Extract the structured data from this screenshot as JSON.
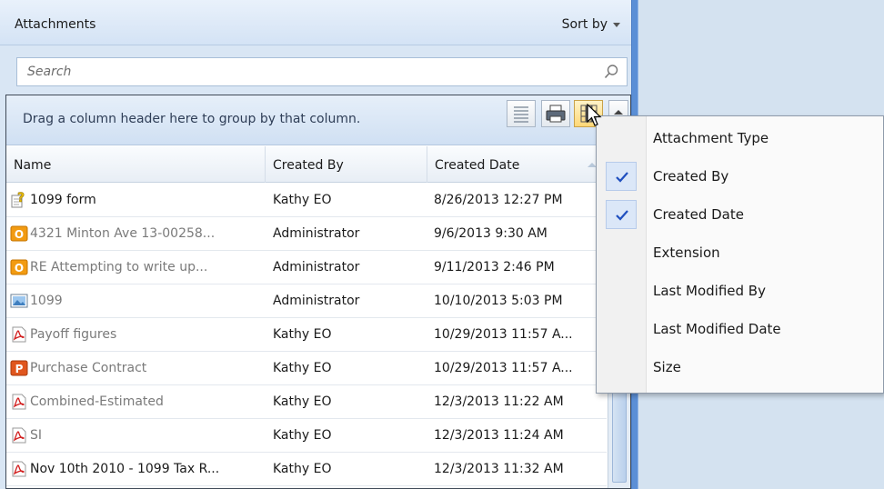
{
  "header": {
    "title": "Attachments",
    "sort_label": "Sort by"
  },
  "search": {
    "placeholder": "Search"
  },
  "grid": {
    "group_hint": "Drag a column header here to group by that column.",
    "columns": [
      "Name",
      "Created By",
      "Created Date"
    ],
    "rows": [
      {
        "icon": "help-doc-icon",
        "name": "1099 form",
        "created_by": "Kathy EO",
        "created_date": "8/26/2013 12:27 PM",
        "name_dim": false
      },
      {
        "icon": "outlook-icon",
        "name": "4321 Minton Ave 13-00258...",
        "created_by": "Administrator",
        "created_date": "9/6/2013 9:30 AM",
        "name_dim": true
      },
      {
        "icon": "outlook-icon",
        "name": "RE  Attempting to write up...",
        "created_by": "Administrator",
        "created_date": "9/11/2013 2:46 PM",
        "name_dim": true
      },
      {
        "icon": "image-icon",
        "name": "1099",
        "created_by": "Administrator",
        "created_date": "10/10/2013 5:03 PM",
        "name_dim": true
      },
      {
        "icon": "pdf-icon",
        "name": "Payoff figures",
        "created_by": "Kathy EO",
        "created_date": "10/29/2013 11:57 A...",
        "name_dim": true
      },
      {
        "icon": "powerpoint-icon",
        "name": "Purchase Contract",
        "created_by": "Kathy EO",
        "created_date": "10/29/2013 11:57 A...",
        "name_dim": true
      },
      {
        "icon": "pdf-icon",
        "name": "Combined-Estimated",
        "created_by": "Kathy EO",
        "created_date": "12/3/2013 11:22 AM",
        "name_dim": true
      },
      {
        "icon": "pdf-icon",
        "name": "SI",
        "created_by": "Kathy EO",
        "created_date": "12/3/2013 11:24 AM",
        "name_dim": true
      },
      {
        "icon": "pdf-icon",
        "name": "Nov 10th 2010 - 1099 Tax R...",
        "created_by": "Kathy EO",
        "created_date": "12/3/2013 11:32 AM",
        "name_dim": false
      }
    ]
  },
  "column_menu": {
    "items": [
      {
        "label": "Attachment Type",
        "checked": false
      },
      {
        "label": "Created By",
        "checked": true
      },
      {
        "label": "Created Date",
        "checked": true
      },
      {
        "label": "Extension",
        "checked": false
      },
      {
        "label": "Last Modified By",
        "checked": false
      },
      {
        "label": "Last Modified Date",
        "checked": false
      },
      {
        "label": "Size",
        "checked": false
      }
    ]
  },
  "colors": {
    "accent": "#5b8fd6",
    "check": "#1f4fbf",
    "pdf": "#c62828",
    "outlook": "#f08c00"
  }
}
